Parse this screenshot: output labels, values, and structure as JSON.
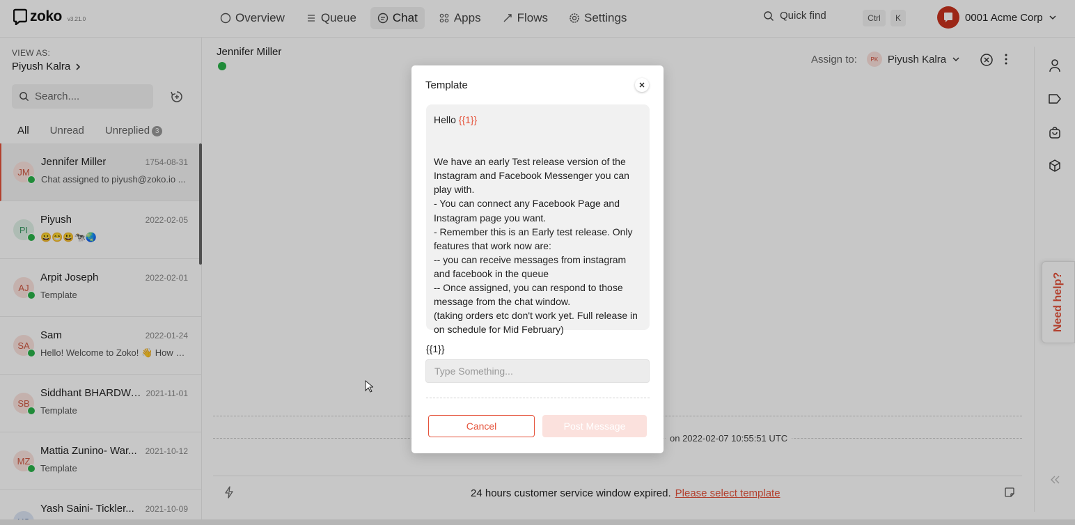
{
  "app": {
    "name": "zoko",
    "version": "v3.21.0"
  },
  "nav": {
    "items": [
      {
        "label": "Overview",
        "icon": "circle-icon"
      },
      {
        "label": "Queue",
        "icon": "list-icon"
      },
      {
        "label": "Chat",
        "icon": "chat-icon",
        "active": true
      },
      {
        "label": "Apps",
        "icon": "grid-icon"
      },
      {
        "label": "Flows",
        "icon": "flow-icon"
      },
      {
        "label": "Settings",
        "icon": "gear-icon"
      }
    ]
  },
  "quickfind": {
    "label": "Quick find",
    "key1": "Ctrl",
    "key2": "K"
  },
  "account": {
    "name": "0001 Acme Corp"
  },
  "sidebar": {
    "view_as_label": "VIEW AS:",
    "view_as_name": "Piyush Kalra",
    "search_placeholder": "Search....",
    "tabs": {
      "all": "All",
      "unread": "Unread",
      "unreplied": "Unreplied",
      "unreplied_count": "3"
    },
    "chats": [
      {
        "initials": "JM",
        "name": "Jennifer Miller",
        "date": "1754-08-31",
        "preview": "Chat assigned to piyush@zoko.io ...",
        "avatar_bg": "#fbe3de",
        "avatar_fg": "#d05a44"
      },
      {
        "initials": "PI",
        "name": "Piyush",
        "date": "2022-02-05",
        "preview": "😀😁😃🐄🌏",
        "avatar_bg": "#dff1e7",
        "avatar_fg": "#3c9a64"
      },
      {
        "initials": "AJ",
        "name": "Arpit Joseph",
        "date": "2022-02-01",
        "preview": "Template",
        "avatar_bg": "#fbe3de",
        "avatar_fg": "#d05a44"
      },
      {
        "initials": "SA",
        "name": "Sam",
        "date": "2022-01-24",
        "preview": "Hello! Welcome to Zoko! 👋 How c...",
        "avatar_bg": "#fbe3de",
        "avatar_fg": "#d05a44"
      },
      {
        "initials": "SB",
        "name": "Siddhant BHARDWA...",
        "date": "2021-11-01",
        "preview": "Template",
        "avatar_bg": "#fbe3de",
        "avatar_fg": "#d05a44"
      },
      {
        "initials": "MZ",
        "name": "Mattia Zunino- War...",
        "date": "2021-10-12",
        "preview": "Template",
        "avatar_bg": "#fbe3de",
        "avatar_fg": "#d05a44"
      },
      {
        "initials": "YS",
        "name": "Yash Saini- Tickler...",
        "date": "2021-10-09",
        "preview": "",
        "avatar_bg": "#dde6f5",
        "avatar_fg": "#4b6fa8"
      }
    ]
  },
  "chat": {
    "contact_name": "Jennifer Miller",
    "assign_label": "Assign to:",
    "assignee_initials": "PK",
    "assignee_name": "Piyush Kalra",
    "system_message": "on 2022-02-07 10:55:51 UTC",
    "window_expired": "24 hours customer service window expired.",
    "select_template_link": "Please select template"
  },
  "help": {
    "label": "Need help?"
  },
  "modal": {
    "title": "Template",
    "greeting": "Hello ",
    "greeting_var": "{{1}}",
    "body": "We have an early Test release version of the Instagram and Facebook Messenger you can play with.\n- You can connect any Facebook Page and Instagram page you want.\n- Remember this is an Early test release. Only features that work now are:\n-- you can receive messages from instagram and facebook in the queue\n-- Once assigned, you can respond to those message from the chat window.\n(taking orders etc don't work yet. Full release in on schedule for Mid February)",
    "var_label": "{{1}}",
    "input_placeholder": "Type Something...",
    "cancel_label": "Cancel",
    "post_label": "Post Message"
  },
  "colors": {
    "accent": "#e5533b",
    "whatsapp": "#2ab34a",
    "brand_avatar": "#c8321e"
  }
}
